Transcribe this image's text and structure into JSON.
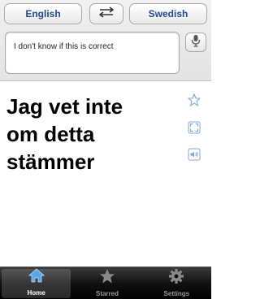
{
  "header": {
    "source_language": "English",
    "target_language": "Swedish",
    "swap_icon": "swap-arrows-icon"
  },
  "input": {
    "text": "I don't know if this is correct",
    "mic_icon": "microphone-icon"
  },
  "result": {
    "line1": "Jag vet inte",
    "line2": "om detta",
    "line3": "stämmer"
  },
  "actions": {
    "star_icon": "star-icon",
    "fullscreen_icon": "fullscreen-icon",
    "speaker_icon": "speaker-icon"
  },
  "tabs": [
    {
      "label": "Home",
      "icon": "home-icon",
      "active": true
    },
    {
      "label": "Starred",
      "icon": "star-icon",
      "active": false
    },
    {
      "label": "Settings",
      "icon": "gear-icon",
      "active": false
    }
  ],
  "colors": {
    "accent": "#1f4a8c",
    "active_tab_icon": "#5aa6e6",
    "inactive_tab": "#9a9a9a",
    "side_icon": "#7fa7d6"
  }
}
